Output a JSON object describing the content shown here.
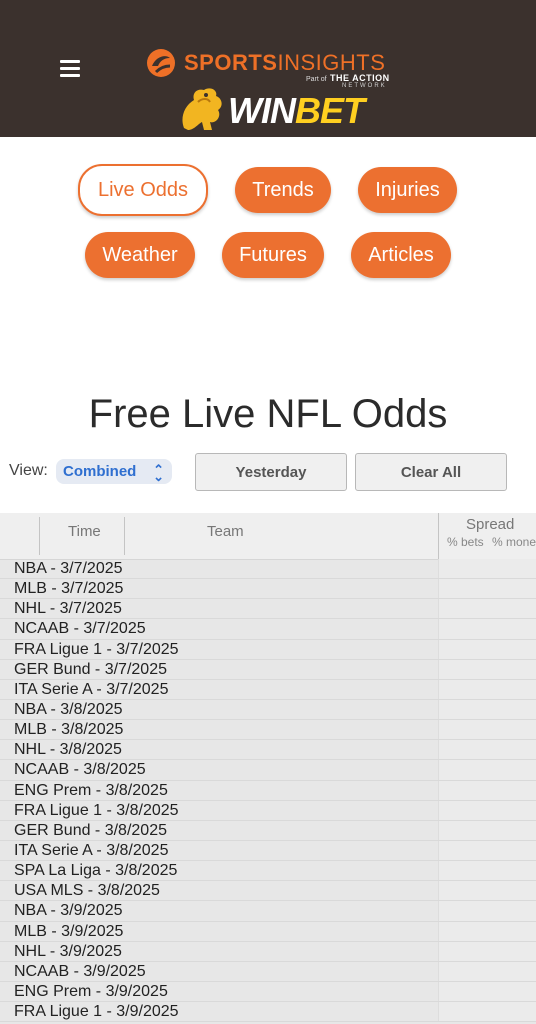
{
  "header": {
    "menu_icon": "hamburger-menu-icon",
    "brand": {
      "sports": "SPORTS",
      "insights": "INSIGHTS",
      "part_of": "Part of",
      "action": "THE ACTION",
      "network": "NETWORK"
    },
    "sponsor": {
      "win": "WIN",
      "bet": "BET"
    },
    "colors": {
      "bar": "#3b312d",
      "brand_orange": "#ee7027",
      "winbet_gold": "#ffcf20"
    }
  },
  "nav": {
    "live_odds": "Live Odds",
    "trends": "Trends",
    "injuries": "Injuries",
    "weather": "Weather",
    "futures": "Futures",
    "articles": "Articles",
    "accent": "#ec7030"
  },
  "page": {
    "title": "Free Live NFL Odds"
  },
  "controls": {
    "view_label": "View:",
    "view_value": "Combined",
    "yesterday": "Yesterday",
    "clear_all": "Clear All"
  },
  "table": {
    "headers": {
      "time": "Time",
      "team": "Team",
      "spread": "Spread",
      "bets": "% bets",
      "money": "% mone"
    },
    "rows": [
      "NBA - 3/7/2025",
      "MLB - 3/7/2025",
      "NHL - 3/7/2025",
      "NCAAB - 3/7/2025",
      "FRA Ligue 1 - 3/7/2025",
      "GER Bund - 3/7/2025",
      "ITA Serie A - 3/7/2025",
      "NBA - 3/8/2025",
      "MLB - 3/8/2025",
      "NHL - 3/8/2025",
      "NCAAB - 3/8/2025",
      "ENG Prem - 3/8/2025",
      "FRA Ligue 1 - 3/8/2025",
      "GER Bund - 3/8/2025",
      "ITA Serie A - 3/8/2025",
      "SPA La Liga - 3/8/2025",
      "USA MLS - 3/8/2025",
      "NBA - 3/9/2025",
      "MLB - 3/9/2025",
      "NHL - 3/9/2025",
      "NCAAB - 3/9/2025",
      "ENG Prem - 3/9/2025",
      "FRA Ligue 1 - 3/9/2025"
    ]
  }
}
